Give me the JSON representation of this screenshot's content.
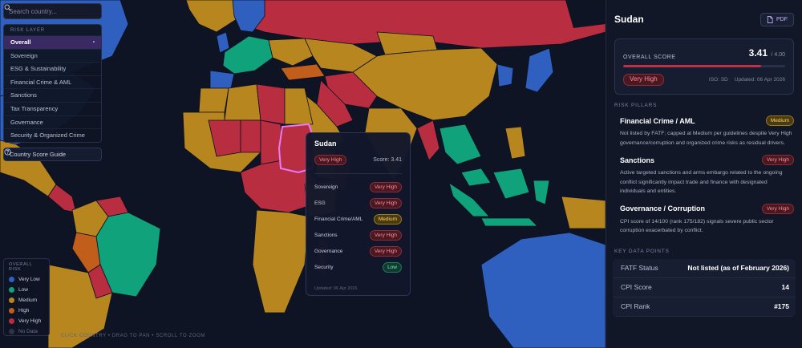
{
  "search": {
    "placeholder": "Search country..."
  },
  "risk_layer": {
    "title": "RISK LAYER",
    "items": [
      {
        "label": "Overall",
        "active": true,
        "marker": "•"
      },
      {
        "label": "Sovereign"
      },
      {
        "label": "ESG & Sustainability"
      },
      {
        "label": "Financial Crime & AML"
      },
      {
        "label": "Sanctions"
      },
      {
        "label": "Tax Transparency"
      },
      {
        "label": "Governance"
      },
      {
        "label": "Security & Organized Crime"
      }
    ]
  },
  "guide_button": {
    "label": "Country Score Guide",
    "icon": "help-circle-icon"
  },
  "legend": {
    "title": "OVERALL RISK",
    "items": [
      {
        "label": "Very Low",
        "color": "#2f5fbf"
      },
      {
        "label": "Low",
        "color": "#10a27a"
      },
      {
        "label": "Medium",
        "color": "#b8861e"
      },
      {
        "label": "High",
        "color": "#c25e1c"
      },
      {
        "label": "Very High",
        "color": "#b82d3f"
      },
      {
        "label": "No Data",
        "color": "#2c3348"
      }
    ]
  },
  "map_hint": "CLICK COUNTRY • DRAG TO PAN • SCROLL TO ZOOM",
  "tooltip": {
    "country": "Sudan",
    "overall_badge": "Very High",
    "score": "Score: 3.41",
    "rows": [
      {
        "label": "Sovereign",
        "badge": "Very High",
        "level": "vh"
      },
      {
        "label": "ESG",
        "badge": "Very High",
        "level": "vh"
      },
      {
        "label": "Financial Crime/AML",
        "badge": "Medium",
        "level": "med"
      },
      {
        "label": "Sanctions",
        "badge": "Very High",
        "level": "vh"
      },
      {
        "label": "Governance",
        "badge": "Very High",
        "level": "vh"
      },
      {
        "label": "Security",
        "badge": "Low",
        "level": "low"
      }
    ],
    "updated": "Updated: 06 Apr 2026"
  },
  "panel": {
    "country": "Sudan",
    "pdf_label": "PDF",
    "score_card": {
      "label": "OVERALL SCORE",
      "value": "3.41",
      "max": "/ 4.00",
      "fill_fraction": 0.8525,
      "badge": "Very High",
      "iso": "ISO: SD",
      "updated": "Updated: 06 Apr 2026"
    },
    "pillars_title": "RISK PILLARS",
    "pillars": [
      {
        "name": "Financial Crime / AML",
        "badge": "Medium",
        "level": "med",
        "text": "Not listed by FATF; capped at Medium per guidelines despite Very High governance/corruption and organized crime risks as residual drivers."
      },
      {
        "name": "Sanctions",
        "badge": "Very High",
        "level": "vh",
        "text": "Active targeted sanctions and arms embargo related to the ongoing conflict significantly impact trade and finance with designated individuals and entities."
      },
      {
        "name": "Governance / Corruption",
        "badge": "Very High",
        "level": "vh",
        "text": "CPI score of 14/100 (rank 175/182) signals severe public sector corruption exacerbated by conflict."
      }
    ],
    "kdp_title": "KEY DATA POINTS",
    "kdp": [
      {
        "label": "FATF Status",
        "value": "Not listed (as of February 2026)"
      },
      {
        "label": "CPI Score",
        "value": "14"
      },
      {
        "label": "CPI Rank",
        "value": "#175"
      }
    ]
  }
}
